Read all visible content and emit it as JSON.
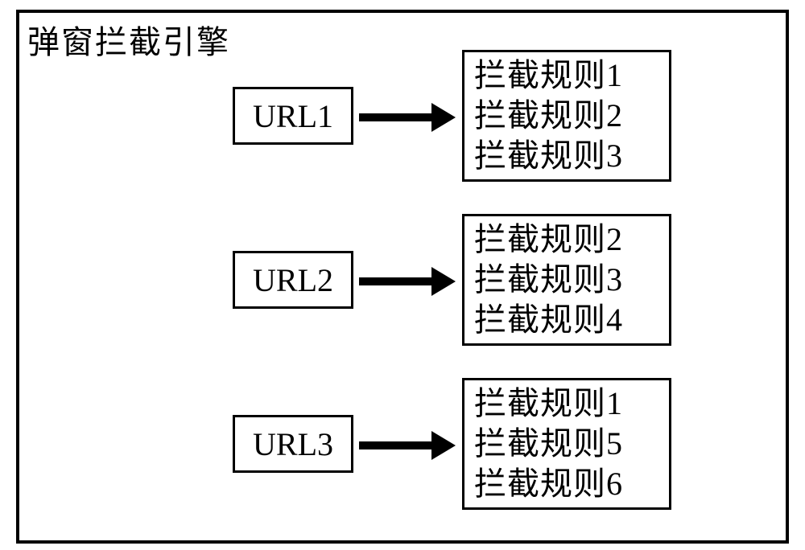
{
  "title": "弹窗拦截引擎",
  "rows": [
    {
      "url_label": "URL1",
      "rules": [
        "拦截规则1",
        "拦截规则2",
        "拦截规则3"
      ]
    },
    {
      "url_label": "URL2",
      "rules": [
        "拦截规则2",
        "拦截规则3",
        "拦截规则4"
      ]
    },
    {
      "url_label": "URL3",
      "rules": [
        "拦截规则1",
        "拦截规则5",
        "拦截规则6"
      ]
    }
  ]
}
